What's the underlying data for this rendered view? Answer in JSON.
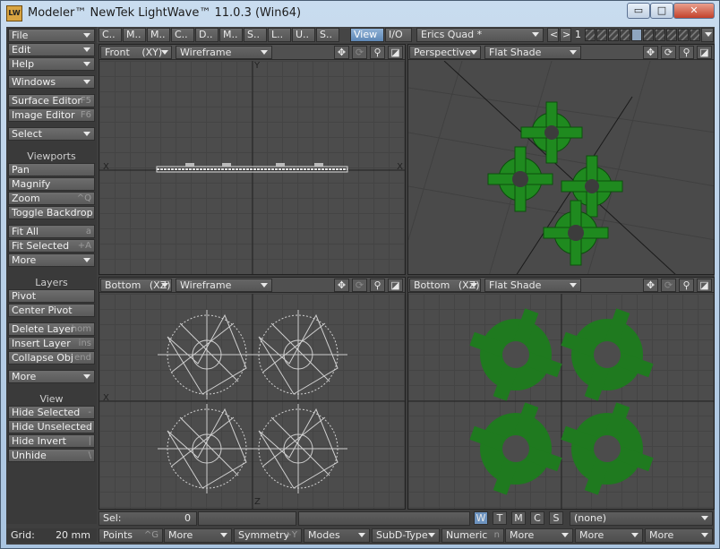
{
  "window": {
    "title": "Modeler™ NewTek LightWave™ 11.0.3 (Win64)",
    "icon": "lightwave-modeler-icon",
    "min": "▭",
    "max": "□",
    "close": "✕"
  },
  "sidebar": {
    "menus": [
      {
        "label": "File"
      },
      {
        "label": "Edit"
      },
      {
        "label": "Help"
      }
    ],
    "windows": "Windows",
    "editors": [
      {
        "label": "Surface Editor",
        "shortcut": "F5"
      },
      {
        "label": "Image Editor",
        "shortcut": "F6"
      }
    ],
    "select": "Select",
    "viewports_header": "Viewports",
    "viewports": [
      {
        "label": "Pan",
        "shortcut": ""
      },
      {
        "label": "Magnify",
        "shortcut": ""
      },
      {
        "label": "Zoom",
        "shortcut": "^Q"
      },
      {
        "label": "Toggle Backdrop",
        "shortcut": ""
      }
    ],
    "fit": [
      {
        "label": "Fit All",
        "shortcut": "a"
      },
      {
        "label": "Fit Selected",
        "shortcut": "+A"
      },
      {
        "label": "More",
        "shortcut": ""
      }
    ],
    "layers_header": "Layers",
    "layers": [
      {
        "label": "Pivot",
        "shortcut": ""
      },
      {
        "label": "Center Pivot",
        "shortcut": ""
      }
    ],
    "layers2": [
      {
        "label": "Delete Layer",
        "shortcut": "hom"
      },
      {
        "label": "Insert Layer",
        "shortcut": "ins"
      },
      {
        "label": "Collapse Obj",
        "shortcut": "end"
      }
    ],
    "layers_more": "More",
    "view_header": "View",
    "view": [
      {
        "label": "Hide Selected",
        "shortcut": "-"
      },
      {
        "label": "Hide Unselected",
        "shortcut": "="
      },
      {
        "label": "Hide Invert",
        "shortcut": "|"
      },
      {
        "label": "Unhide",
        "shortcut": "\\"
      }
    ]
  },
  "toolbar": {
    "tabs": [
      "C..",
      "M..",
      "M..",
      "C..",
      "D..",
      "M..",
      "S..",
      "L..",
      "U..",
      "S.."
    ],
    "view_tab": "View",
    "io_tab": "I/O",
    "layout": "Erics Quad *",
    "layer_nav_prev": "<",
    "layer_nav_next": ">",
    "layer_num": "1"
  },
  "viewports": [
    {
      "view": "Front",
      "axis": "(XY)",
      "mode": "Wireframe"
    },
    {
      "view": "Perspective",
      "axis": "",
      "mode": "Flat Shade"
    },
    {
      "view": "Bottom",
      "axis": "(XZ)",
      "mode": "Wireframe"
    },
    {
      "view": "Bottom",
      "axis": "(XZ)",
      "mode": "Flat Shade"
    }
  ],
  "icons": {
    "move": "✥",
    "rotate": "⟳",
    "zoom": "⚲",
    "maximize": "◪"
  },
  "axis_labels": {
    "y": "Y",
    "x": "X",
    "z": "Z"
  },
  "status": {
    "sel_label": "Sel:",
    "sel_value": "0",
    "wmc": [
      "W",
      "T",
      "M",
      "C",
      "S"
    ],
    "none": "(none)"
  },
  "bottom": {
    "grid_label": "Grid:",
    "grid_value": "20 mm",
    "points": "Points",
    "points_sc": "^G",
    "more1": "More",
    "symmetry": "Symmetry",
    "symmetry_sc": "+Y",
    "modes": "Modes",
    "subd": "SubD-Type",
    "numeric": "Numeric",
    "numeric_sc": "n",
    "more2": "More",
    "more3": "More",
    "more4": "More"
  },
  "colors": {
    "active_tab": "#6d93bf",
    "model_green": "#1f7a1f",
    "accent": "#5e87b6"
  }
}
